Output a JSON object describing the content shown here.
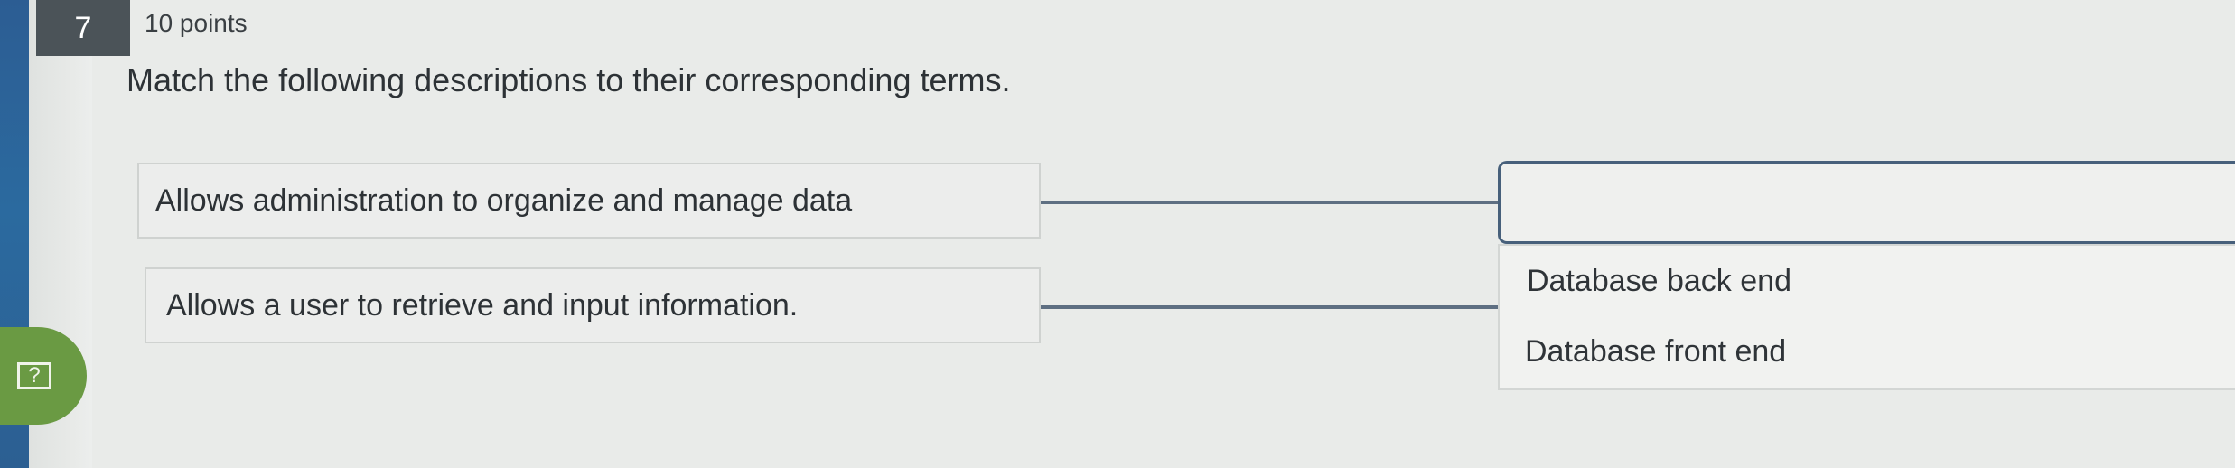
{
  "question": {
    "number": "7",
    "points": "10 points",
    "prompt": "Match the following descriptions to their corresponding terms."
  },
  "descriptions": [
    {
      "label": "Allows administration to organize and manage data"
    },
    {
      "label": "Allows a user to retrieve and input information."
    }
  ],
  "drop_target": {
    "value": ""
  },
  "options": [
    {
      "label": "Database back end"
    },
    {
      "label": "Database front end"
    }
  ],
  "help": {
    "icon_glyph": "?"
  },
  "colors": {
    "rail": "#2c5d93",
    "help_button": "#6a9a43",
    "connector": "#5e6f82",
    "number_badge": "#4b5358"
  }
}
